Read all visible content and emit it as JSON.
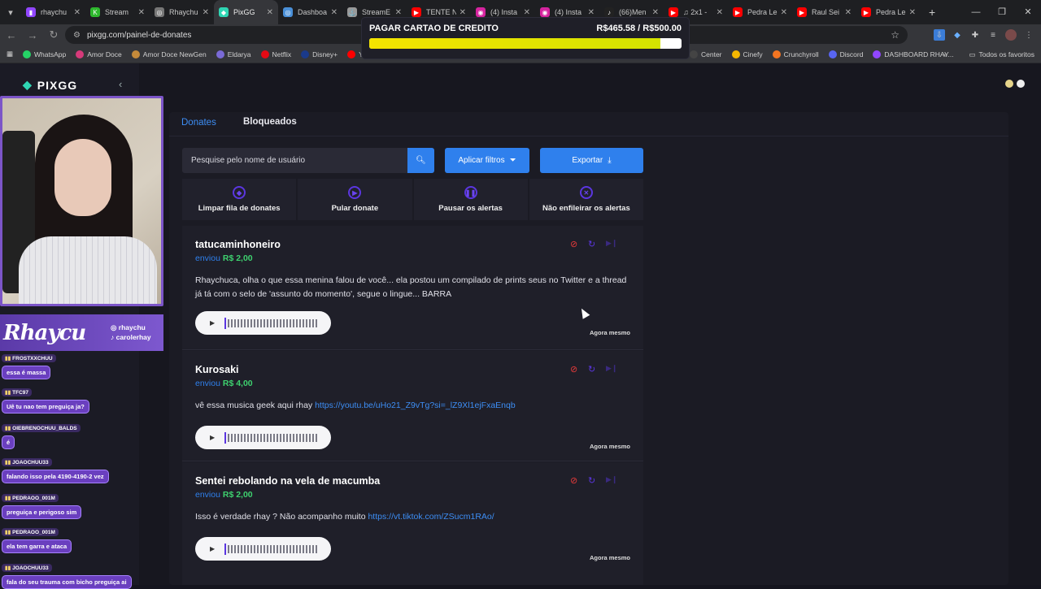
{
  "browser": {
    "tabs": [
      {
        "label": "rhaychu",
        "color": "#9146ff",
        "glyph": "▮"
      },
      {
        "label": "Stream",
        "color": "#2eb82e",
        "glyph": "K"
      },
      {
        "label": "Rhaychu",
        "color": "#777777",
        "glyph": "◎"
      },
      {
        "label": "PixGG",
        "color": "#2fd6b4",
        "glyph": "◆"
      },
      {
        "label": "Dashboa",
        "color": "#4a90d9",
        "glyph": "◎"
      },
      {
        "label": "StreamE",
        "color": "#999999",
        "glyph": "⚓"
      },
      {
        "label": "TENTE N",
        "color": "#ff0000",
        "glyph": "▶"
      },
      {
        "label": "(4) Insta",
        "color": "#d6249f",
        "glyph": "◉"
      },
      {
        "label": "(4) Insta",
        "color": "#d6249f",
        "glyph": "◉"
      },
      {
        "label": "(66)Men",
        "color": "#222222",
        "glyph": "♪"
      },
      {
        "label": "♫ 2x1 -",
        "color": "#ff0000",
        "glyph": "▶"
      },
      {
        "label": "Pedra Le",
        "color": "#ff0000",
        "glyph": "▶"
      },
      {
        "label": "Raul Sei",
        "color": "#ff0000",
        "glyph": "▶"
      },
      {
        "label": "Pedra Le",
        "color": "#ff0000",
        "glyph": "▶"
      }
    ],
    "url": "pixgg.com/painel-de-donates",
    "bookmarks_left": [
      {
        "label": "WhatsApp",
        "color": "#25d366"
      },
      {
        "label": "Amor Doce",
        "color": "#d63a7a"
      },
      {
        "label": "Amor Doce NewGen",
        "color": "#c48a3a"
      },
      {
        "label": "Eldarya",
        "color": "#7a6ad6"
      },
      {
        "label": "Netflix",
        "color": "#e50914"
      },
      {
        "label": "Disney+",
        "color": "#1a3a8a"
      },
      {
        "label": "Yo",
        "color": "#ff0000"
      }
    ],
    "bookmarks_right": [
      {
        "label": "Center",
        "color": "#444444"
      },
      {
        "label": "Cinefy",
        "color": "#f5b800"
      },
      {
        "label": "Crunchyroll",
        "color": "#f47521"
      },
      {
        "label": "Discord",
        "color": "#5865f2"
      },
      {
        "label": "DASHBOARD RHAY...",
        "color": "#9146ff"
      }
    ],
    "all_bookmarks": "Todos os favoritos"
  },
  "goal": {
    "title": "PAGAR CARTAO DE CREDITO",
    "amount": "R$465.58 / R$500.00",
    "progress": 0.931
  },
  "app": {
    "logo": "PIXGG",
    "tabs": {
      "donates": "Donates",
      "blocked": "Bloqueados"
    },
    "search_placeholder": "Pesquise pelo nome de usuário",
    "filter_label": "Aplicar filtros",
    "export_label": "Exportar",
    "actions": [
      {
        "label": "Limpar fila de donates",
        "icon": "eraser-icon",
        "glyph": "◆"
      },
      {
        "label": "Pular donate",
        "icon": "skip-icon",
        "glyph": "▶"
      },
      {
        "label": "Pausar os alertas",
        "icon": "pause-icon",
        "glyph": "❚❚"
      },
      {
        "label": "Não enfileirar os alertas",
        "icon": "bell-off-icon",
        "glyph": "✕"
      }
    ],
    "donations": [
      {
        "name": "tatucaminhoneiro",
        "sent_label": "enviou",
        "amount": "R$ 2,00",
        "message": "Rhaychuca, olha o que essa menina falou de você... ela postou um compilado de prints seus no Twitter e a thread já tá com o selo de 'assunto do momento', segue o lingue... BARRA",
        "link": "",
        "time": "Agora mesmo"
      },
      {
        "name": "Kurosaki",
        "sent_label": "enviou",
        "amount": "R$ 4,00",
        "message": "vê essa musica geek aqui rhay ",
        "link": "https://youtu.be/uHo21_Z9vTg?si=_lZ9Xl1ejFxaEnqb",
        "time": "Agora mesmo"
      },
      {
        "name": "Sentei rebolando na vela de macumba",
        "sent_label": "enviou",
        "amount": "R$ 2,00",
        "message": "Isso é verdade rhay ? Não acompanho muito ",
        "link": "https://vt.tiktok.com/ZSucm1RAo/",
        "time": "Agora mesmo"
      }
    ]
  },
  "stream": {
    "brand_signature": "Rhaycu",
    "handles": [
      "rhaychu",
      "carolerhay"
    ],
    "chat": [
      {
        "user": "FROSTXXCHUU",
        "text": "essa é massa"
      },
      {
        "user": "TFC97",
        "text": "Uê tu nao tem preguiça ja?"
      },
      {
        "user": "OIEBRENOCHUU_BALDS",
        "text": "é"
      },
      {
        "user": "JOAOCHUU33",
        "text": "falando isso pela 4190-4190-2 vez"
      },
      {
        "user": "PEDRAOO_001M",
        "text": "preguiça e perigoso sim"
      },
      {
        "user": "PEDRAOO_001M",
        "text": "ela tem garra e ataca"
      },
      {
        "user": "JOAOCHUU33",
        "text": "fala do seu trauma com bicho preguiça ai"
      }
    ]
  }
}
